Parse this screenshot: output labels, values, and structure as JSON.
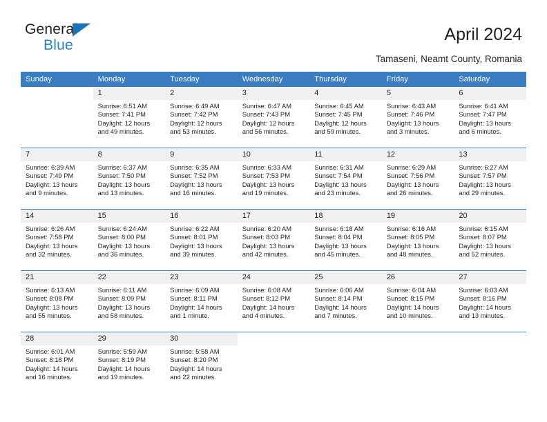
{
  "brand": {
    "name_top": "General",
    "name_bottom": "Blue",
    "triangle_color": "#1b72b8",
    "blue_text_color": "#2384c8"
  },
  "header": {
    "title": "April 2024",
    "subtitle": "Tamaseni, Neamt County, Romania"
  },
  "theme": {
    "header_bg": "#3b7dc0",
    "header_text": "#ffffff",
    "daynum_bg": "#f0f0f0",
    "row_divider": "#3b7dc0",
    "body_text": "#231f20"
  },
  "weekdays": [
    "Sunday",
    "Monday",
    "Tuesday",
    "Wednesday",
    "Thursday",
    "Friday",
    "Saturday"
  ],
  "labels": {
    "sunrise_prefix": "Sunrise:",
    "sunset_prefix": "Sunset:",
    "daylight_prefix": "Daylight:"
  },
  "weeks": [
    [
      {
        "day": "",
        "sunrise": "",
        "sunset": "",
        "daylight_line1": "",
        "daylight_line2": ""
      },
      {
        "day": "1",
        "sunrise": "Sunrise: 6:51 AM",
        "sunset": "Sunset: 7:41 PM",
        "daylight_line1": "Daylight: 12 hours",
        "daylight_line2": "and 49 minutes."
      },
      {
        "day": "2",
        "sunrise": "Sunrise: 6:49 AM",
        "sunset": "Sunset: 7:42 PM",
        "daylight_line1": "Daylight: 12 hours",
        "daylight_line2": "and 53 minutes."
      },
      {
        "day": "3",
        "sunrise": "Sunrise: 6:47 AM",
        "sunset": "Sunset: 7:43 PM",
        "daylight_line1": "Daylight: 12 hours",
        "daylight_line2": "and 56 minutes."
      },
      {
        "day": "4",
        "sunrise": "Sunrise: 6:45 AM",
        "sunset": "Sunset: 7:45 PM",
        "daylight_line1": "Daylight: 12 hours",
        "daylight_line2": "and 59 minutes."
      },
      {
        "day": "5",
        "sunrise": "Sunrise: 6:43 AM",
        "sunset": "Sunset: 7:46 PM",
        "daylight_line1": "Daylight: 13 hours",
        "daylight_line2": "and 3 minutes."
      },
      {
        "day": "6",
        "sunrise": "Sunrise: 6:41 AM",
        "sunset": "Sunset: 7:47 PM",
        "daylight_line1": "Daylight: 13 hours",
        "daylight_line2": "and 6 minutes."
      }
    ],
    [
      {
        "day": "7",
        "sunrise": "Sunrise: 6:39 AM",
        "sunset": "Sunset: 7:49 PM",
        "daylight_line1": "Daylight: 13 hours",
        "daylight_line2": "and 9 minutes."
      },
      {
        "day": "8",
        "sunrise": "Sunrise: 6:37 AM",
        "sunset": "Sunset: 7:50 PM",
        "daylight_line1": "Daylight: 13 hours",
        "daylight_line2": "and 13 minutes."
      },
      {
        "day": "9",
        "sunrise": "Sunrise: 6:35 AM",
        "sunset": "Sunset: 7:52 PM",
        "daylight_line1": "Daylight: 13 hours",
        "daylight_line2": "and 16 minutes."
      },
      {
        "day": "10",
        "sunrise": "Sunrise: 6:33 AM",
        "sunset": "Sunset: 7:53 PM",
        "daylight_line1": "Daylight: 13 hours",
        "daylight_line2": "and 19 minutes."
      },
      {
        "day": "11",
        "sunrise": "Sunrise: 6:31 AM",
        "sunset": "Sunset: 7:54 PM",
        "daylight_line1": "Daylight: 13 hours",
        "daylight_line2": "and 23 minutes."
      },
      {
        "day": "12",
        "sunrise": "Sunrise: 6:29 AM",
        "sunset": "Sunset: 7:56 PM",
        "daylight_line1": "Daylight: 13 hours",
        "daylight_line2": "and 26 minutes."
      },
      {
        "day": "13",
        "sunrise": "Sunrise: 6:27 AM",
        "sunset": "Sunset: 7:57 PM",
        "daylight_line1": "Daylight: 13 hours",
        "daylight_line2": "and 29 minutes."
      }
    ],
    [
      {
        "day": "14",
        "sunrise": "Sunrise: 6:26 AM",
        "sunset": "Sunset: 7:58 PM",
        "daylight_line1": "Daylight: 13 hours",
        "daylight_line2": "and 32 minutes."
      },
      {
        "day": "15",
        "sunrise": "Sunrise: 6:24 AM",
        "sunset": "Sunset: 8:00 PM",
        "daylight_line1": "Daylight: 13 hours",
        "daylight_line2": "and 36 minutes."
      },
      {
        "day": "16",
        "sunrise": "Sunrise: 6:22 AM",
        "sunset": "Sunset: 8:01 PM",
        "daylight_line1": "Daylight: 13 hours",
        "daylight_line2": "and 39 minutes."
      },
      {
        "day": "17",
        "sunrise": "Sunrise: 6:20 AM",
        "sunset": "Sunset: 8:03 PM",
        "daylight_line1": "Daylight: 13 hours",
        "daylight_line2": "and 42 minutes."
      },
      {
        "day": "18",
        "sunrise": "Sunrise: 6:18 AM",
        "sunset": "Sunset: 8:04 PM",
        "daylight_line1": "Daylight: 13 hours",
        "daylight_line2": "and 45 minutes."
      },
      {
        "day": "19",
        "sunrise": "Sunrise: 6:16 AM",
        "sunset": "Sunset: 8:05 PM",
        "daylight_line1": "Daylight: 13 hours",
        "daylight_line2": "and 48 minutes."
      },
      {
        "day": "20",
        "sunrise": "Sunrise: 6:15 AM",
        "sunset": "Sunset: 8:07 PM",
        "daylight_line1": "Daylight: 13 hours",
        "daylight_line2": "and 52 minutes."
      }
    ],
    [
      {
        "day": "21",
        "sunrise": "Sunrise: 6:13 AM",
        "sunset": "Sunset: 8:08 PM",
        "daylight_line1": "Daylight: 13 hours",
        "daylight_line2": "and 55 minutes."
      },
      {
        "day": "22",
        "sunrise": "Sunrise: 6:11 AM",
        "sunset": "Sunset: 8:09 PM",
        "daylight_line1": "Daylight: 13 hours",
        "daylight_line2": "and 58 minutes."
      },
      {
        "day": "23",
        "sunrise": "Sunrise: 6:09 AM",
        "sunset": "Sunset: 8:11 PM",
        "daylight_line1": "Daylight: 14 hours",
        "daylight_line2": "and 1 minute."
      },
      {
        "day": "24",
        "sunrise": "Sunrise: 6:08 AM",
        "sunset": "Sunset: 8:12 PM",
        "daylight_line1": "Daylight: 14 hours",
        "daylight_line2": "and 4 minutes."
      },
      {
        "day": "25",
        "sunrise": "Sunrise: 6:06 AM",
        "sunset": "Sunset: 8:14 PM",
        "daylight_line1": "Daylight: 14 hours",
        "daylight_line2": "and 7 minutes."
      },
      {
        "day": "26",
        "sunrise": "Sunrise: 6:04 AM",
        "sunset": "Sunset: 8:15 PM",
        "daylight_line1": "Daylight: 14 hours",
        "daylight_line2": "and 10 minutes."
      },
      {
        "day": "27",
        "sunrise": "Sunrise: 6:03 AM",
        "sunset": "Sunset: 8:16 PM",
        "daylight_line1": "Daylight: 14 hours",
        "daylight_line2": "and 13 minutes."
      }
    ],
    [
      {
        "day": "28",
        "sunrise": "Sunrise: 6:01 AM",
        "sunset": "Sunset: 8:18 PM",
        "daylight_line1": "Daylight: 14 hours",
        "daylight_line2": "and 16 minutes."
      },
      {
        "day": "29",
        "sunrise": "Sunrise: 5:59 AM",
        "sunset": "Sunset: 8:19 PM",
        "daylight_line1": "Daylight: 14 hours",
        "daylight_line2": "and 19 minutes."
      },
      {
        "day": "30",
        "sunrise": "Sunrise: 5:58 AM",
        "sunset": "Sunset: 8:20 PM",
        "daylight_line1": "Daylight: 14 hours",
        "daylight_line2": "and 22 minutes."
      },
      {
        "day": "",
        "sunrise": "",
        "sunset": "",
        "daylight_line1": "",
        "daylight_line2": ""
      },
      {
        "day": "",
        "sunrise": "",
        "sunset": "",
        "daylight_line1": "",
        "daylight_line2": ""
      },
      {
        "day": "",
        "sunrise": "",
        "sunset": "",
        "daylight_line1": "",
        "daylight_line2": ""
      },
      {
        "day": "",
        "sunrise": "",
        "sunset": "",
        "daylight_line1": "",
        "daylight_line2": ""
      }
    ]
  ]
}
